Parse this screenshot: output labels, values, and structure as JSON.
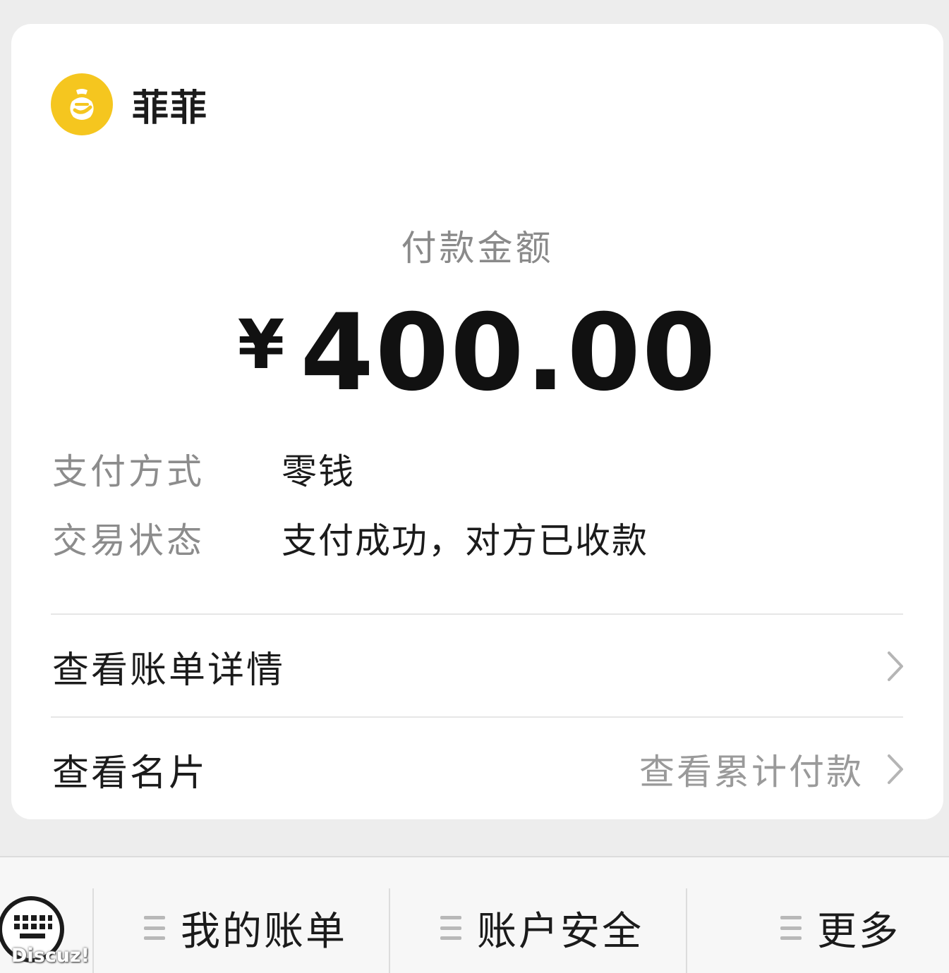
{
  "merchant": {
    "name": "菲菲",
    "logo_color": "#f5c61f"
  },
  "payment": {
    "amount_label": "付款金额",
    "currency_symbol": "¥",
    "amount": "400.00"
  },
  "details": [
    {
      "key": "支付方式",
      "value": "零钱"
    },
    {
      "key": "交易状态",
      "value": "支付成功，对方已收款"
    }
  ],
  "links": {
    "bill_details": "查看账单详情",
    "business_card": "查看名片",
    "cumulative_payments": "查看累计付款"
  },
  "bottom_menu": {
    "items": [
      {
        "label": "我的账单"
      },
      {
        "label": "账户安全"
      },
      {
        "label": "更多"
      }
    ]
  },
  "watermark": "Discuz!"
}
